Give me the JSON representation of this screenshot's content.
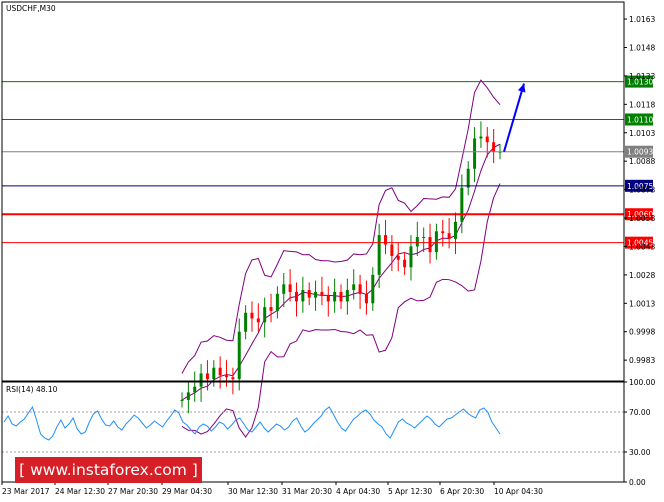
{
  "chart_data": [
    {
      "type": "candlestick",
      "title": "USDCHF,M30",
      "ylim": [
        0.9972,
        1.0172
      ],
      "y_ticks": [
        "1.0163",
        "1.0148",
        "1.0133",
        "1.0118",
        "1.0103",
        "1.0088",
        "1.0073",
        "1.0058",
        "1.0043",
        "1.0028",
        "1.0013",
        "0.9998",
        "0.9983"
      ],
      "x_labels": [
        "23 Mar 2017",
        "24 Mar 12:30",
        "27 Mar 20:30",
        "29 Mar 04:30",
        "30 Mar 12:30",
        "31 Mar 20:30",
        "4 Apr 04:30",
        "5 Apr 12:30",
        "6 Apr 20:30",
        "10 Apr 04:30"
      ],
      "levels": [
        {
          "value": 1.013,
          "label": "1.0130",
          "color": "#008000"
        },
        {
          "value": 1.011,
          "label": "1.0110",
          "color": "#008000"
        },
        {
          "value": 1.0093,
          "label": "1.0093",
          "color": "#808080"
        },
        {
          "value": 1.0075,
          "label": "1.0075",
          "color": "#000080"
        },
        {
          "value": 1.006,
          "label": "1.0060",
          "color": "#ff0000"
        },
        {
          "value": 1.0045,
          "label": "1.0045",
          "color": "#ff0000"
        }
      ],
      "close_series": [
        0.9962,
        0.9966,
        0.9969,
        0.9976,
        0.9973,
        0.9979,
        0.9975,
        0.9974,
        0.9973,
        0.9998,
        1.0008,
        1.0005,
        1.0003,
        1.0011,
        1.0009,
        1.0018,
        1.0023,
        1.0019,
        1.0014,
        1.002,
        1.0016,
        1.0019,
        1.0017,
        1.0014,
        1.0019,
        1.0014,
        1.002,
        1.0023,
        1.0018,
        1.0013,
        1.0028,
        1.0049,
        1.0044,
        1.0038,
        1.0036,
        1.0032,
        1.0043,
        1.0048,
        1.0048,
        1.004,
        1.0051,
        1.005,
        1.0047,
        1.0056,
        1.0074,
        1.0084,
        1.01,
        1.0101,
        1.0098,
        1.0093,
        1.0093
      ],
      "forecast_arrow": {
        "from": 1.0093,
        "to": 1.013,
        "color": "#0000ff"
      }
    },
    {
      "type": "line",
      "title": "RSI(14) 48.10",
      "ylim": [
        0,
        100
      ],
      "y_ticks": [
        "100.00",
        "70.00",
        "30.00",
        "0.00"
      ],
      "levels": [
        70,
        30
      ],
      "values": [
        60,
        66,
        58,
        56,
        60,
        63,
        69,
        75,
        62,
        48,
        44,
        42,
        46,
        55,
        62,
        54,
        58,
        64,
        53,
        48,
        50,
        60,
        68,
        71,
        63,
        57,
        56,
        61,
        55,
        52,
        58,
        62,
        67,
        64,
        59,
        54,
        57,
        61,
        58,
        55,
        61,
        66,
        72,
        69,
        60,
        57,
        52,
        48,
        55,
        58,
        56,
        51,
        55,
        60,
        58,
        53,
        57,
        62,
        64,
        58,
        52,
        50,
        55,
        60,
        54,
        50,
        54,
        58,
        56,
        52,
        55,
        61,
        64,
        56,
        50,
        53,
        58,
        62,
        66,
        72,
        75,
        68,
        60,
        54,
        51,
        57,
        63,
        66,
        70,
        72,
        68,
        62,
        58,
        55,
        48,
        44,
        52,
        60,
        63,
        59,
        57,
        54,
        58,
        62,
        66,
        63,
        58,
        55,
        59,
        63,
        64,
        67,
        70,
        73,
        69,
        66,
        64,
        72,
        74,
        70,
        60,
        54,
        48
      ]
    }
  ],
  "watermark": {
    "text": "[  www.instaforex.com  ]"
  },
  "colors": {
    "bull": "#008000",
    "bear": "#ff0000",
    "bands": "#800080",
    "rsi": "#1e90ff"
  }
}
